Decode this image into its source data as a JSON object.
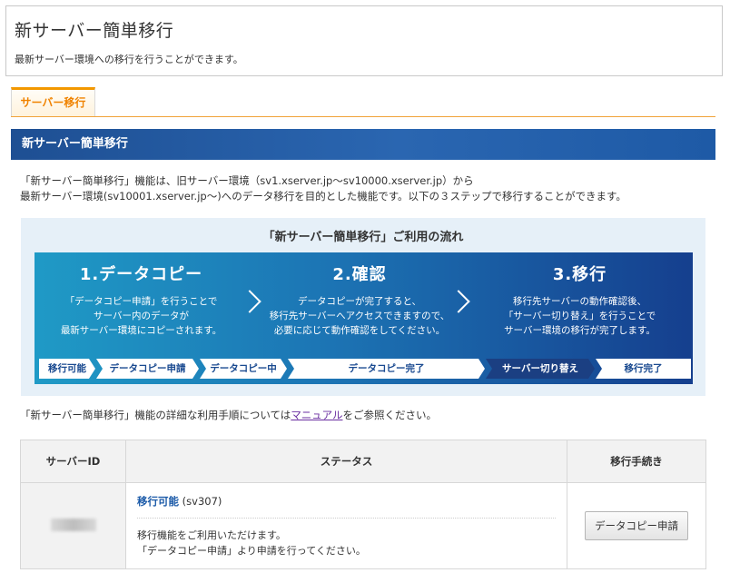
{
  "header": {
    "title": "新サーバー簡単移行",
    "subtitle": "最新サーバー環境への移行を行うことができます。"
  },
  "tabs": [
    {
      "label": "サーバー移行",
      "active": true
    }
  ],
  "section": {
    "title": "新サーバー簡単移行"
  },
  "intro": {
    "line1": "「新サーバー簡単移行」機能は、旧サーバー環境（sv1.xserver.jp〜sv10000.xserver.jp）から",
    "line2": "最新サーバー環境(sv10001.xserver.jp〜)へのデータ移行を目的とした機能です。以下の３ステップで移行することができます。"
  },
  "flow": {
    "title": "「新サーバー簡単移行」ご利用の流れ",
    "steps": [
      {
        "num": "1.データコピー",
        "lines": [
          "「データコピー申請」を行うことで",
          "サーバー内のデータが",
          "最新サーバー環境にコピーされます。"
        ]
      },
      {
        "num": "2.確認",
        "lines": [
          "データコピーが完了すると、",
          "移行先サーバーへアクセスできますので、",
          "必要に応じて動作確認をしてください。"
        ]
      },
      {
        "num": "3.移行",
        "lines": [
          "移行先サーバーの動作確認後、",
          "「サーバー切り替え」を行うことで",
          "サーバー環境の移行が完了します。"
        ]
      }
    ],
    "stages": [
      "移行可能",
      "データコピー申請",
      "データコピー中",
      "データコピー完了",
      "サーバー切り替え",
      "移行完了"
    ]
  },
  "manual": {
    "prefix": "「新サーバー簡単移行」機能の詳細な利用手順については",
    "link": "マニュアル",
    "suffix": "をご参照ください。"
  },
  "table": {
    "headers": [
      "サーバーID",
      "ステータス",
      "移行手続き"
    ],
    "row": {
      "status": "移行可能",
      "server": "(sv307)",
      "msg1": "移行機能をご利用いただけます。",
      "msg2": "「データコピー申請」より申請を行ってください。",
      "action": "データコピー申請"
    }
  },
  "colors": {
    "accent_orange": "#f39800",
    "brand_blue": "#1e4f93"
  }
}
